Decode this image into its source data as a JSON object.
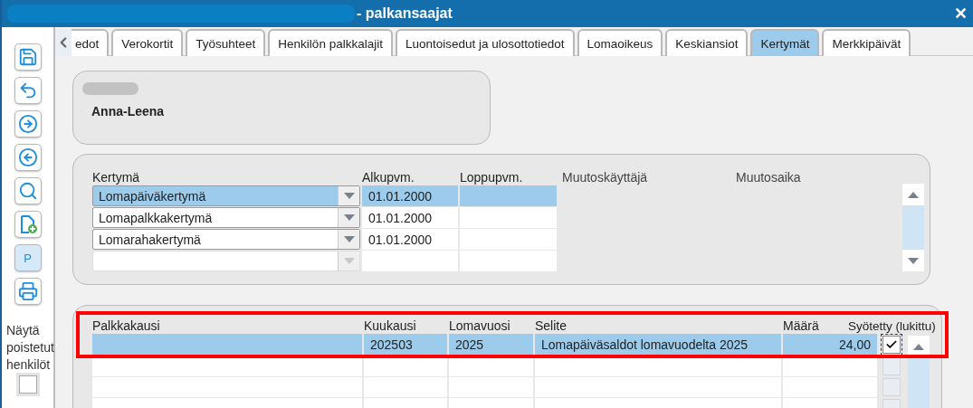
{
  "window": {
    "title": "- palkansaajat",
    "close": "✕"
  },
  "toolbar": [
    {
      "kind": "save",
      "selected": false
    },
    {
      "kind": "undo",
      "selected": false
    },
    {
      "kind": "next",
      "selected": false
    },
    {
      "kind": "previous",
      "selected": false
    },
    {
      "kind": "search",
      "selected": false
    },
    {
      "kind": "new-document",
      "selected": false
    },
    {
      "kind": "text",
      "label": "P",
      "selected": true
    },
    {
      "kind": "print",
      "selected": false
    }
  ],
  "show_deleted": {
    "label": "Näytä poistetut henkilöt",
    "checked": false
  },
  "tabs": [
    {
      "label": "edot",
      "selected": false
    },
    {
      "label": "Verokortit",
      "selected": false
    },
    {
      "label": "Työsuhteet",
      "selected": false
    },
    {
      "label": "Henkilön palkkalajit",
      "selected": false
    },
    {
      "label": "Luontoisedut ja ulosottotiedot",
      "selected": false
    },
    {
      "label": "Lomaoikeus",
      "selected": false
    },
    {
      "label": "Keskiansiot",
      "selected": false
    },
    {
      "label": "Kertymät",
      "selected": true
    },
    {
      "label": "Merkkipäivät",
      "selected": false
    }
  ],
  "person": {
    "name": "Anna-Leena"
  },
  "accruals": {
    "columns": [
      "Kertymä",
      "Alkupvm.",
      "Loppupvm.",
      "Muutoskäyttäjä",
      "Muutosaika"
    ],
    "rows": [
      {
        "type": "Lomapäiväkertymä",
        "start": "01.01.2000",
        "selected": true
      },
      {
        "type": "Lomapalkkakertymä",
        "start": "01.01.2000",
        "selected": false
      },
      {
        "type": "Lomarahakertymä",
        "start": "01.01.2000",
        "selected": false
      }
    ]
  },
  "entries": {
    "highlighted": true,
    "columns": [
      "Palkkakausi",
      "Kuukausi",
      "Lomavuosi",
      "Selite",
      "Määrä",
      "Syötetty (lukittu)"
    ],
    "rows": [
      {
        "kind": "entry",
        "month": "202503",
        "year": "2025",
        "description": "Lomapäiväsaldot lomavuodelta 2025",
        "amount": "24,00",
        "locked": true,
        "disabled": false,
        "selected": true
      },
      {
        "kind": "blank",
        "locked": false,
        "disabled": true,
        "selected": false
      },
      {
        "kind": "blank",
        "locked": false,
        "disabled": true,
        "selected": false
      },
      {
        "kind": "blank",
        "locked": false,
        "disabled": true,
        "selected": false
      }
    ]
  }
}
